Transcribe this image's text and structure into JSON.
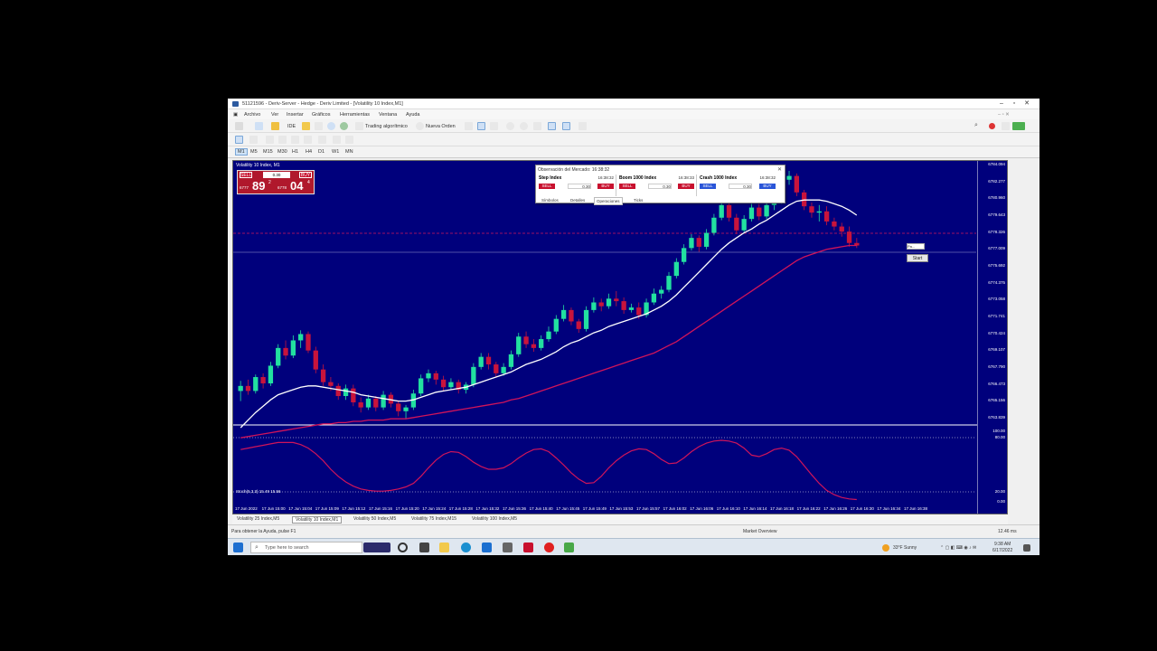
{
  "window": {
    "title": "51121596 - Deriv-Server - Hedge - Deriv Limited - [Volatility 10 Index,M1]"
  },
  "menu": [
    "Archivo",
    "Ver",
    "Insertar",
    "Gráficos",
    "Herramientas",
    "Ventana",
    "Ayuda"
  ],
  "toolbar": {
    "ide_label": "IDE",
    "algo_trading": "Trading algorítmico",
    "new_order": "Nueva Orden"
  },
  "timeframes": [
    "M1",
    "M5",
    "M15",
    "M30",
    "H1",
    "H4",
    "D1",
    "W1",
    "MN"
  ],
  "active_timeframe": "M1",
  "chart": {
    "title": "Volatility 10 Index, M1",
    "background": "#00007c",
    "bull_color": "#22e0a0",
    "bear_color": "#c8143c",
    "fast_ma_color": "#ffffff",
    "slow_ma_color": "#d0145a",
    "price_labels": [
      "6784.094",
      "6782.277",
      "6780.960",
      "6779.643",
      "6778.326",
      "6777.009",
      "6775.692",
      "6774.375",
      "6773.058",
      "6771.741",
      "6770.424",
      "6769.107",
      "6767.790",
      "6766.473",
      "6765.156",
      "6763.839"
    ],
    "time_labels": [
      "17 Jun 2022",
      "17 Jun 15:00",
      "17 Jun 15:04",
      "17 Jun 15:09",
      "17 Jun 15:12",
      "17 Jun 15:16",
      "17 Jun 15:20",
      "17 Jun 15:24",
      "17 Jun 15:28",
      "17 Jun 15:32",
      "17 Jun 15:36",
      "17 Jun 15:40",
      "17 Jun 15:45",
      "17 Jun 15:49",
      "17 Jun 15:53",
      "17 Jun 15:57",
      "17 Jun 16:02",
      "17 Jun 16:06",
      "17 Jun 16:10",
      "17 Jun 16:14",
      "17 Jun 16:18",
      "17 Jun 16:22",
      "17 Jun 16:26",
      "17 Jun 16:30",
      "17 Jun 16:34",
      "17 Jun 16:38"
    ],
    "oscillator_title": "Stoch(5,3,3) 15.49 15.56",
    "osc_levels": [
      "100.00",
      "80.00",
      "20.00",
      "0.00"
    ]
  },
  "trade_panel": {
    "sell": "SELL",
    "buy": "BUY",
    "lot": "0.30",
    "sell_small": "6777",
    "sell_big": "89",
    "sell_sup": "2",
    "buy_small": "6778",
    "buy_big": "04",
    "buy_sup": "4"
  },
  "market_watch": {
    "title": "Observación del Mercado: 16:38:32",
    "symbols": [
      {
        "name": "Step Index",
        "time": "16:38:32",
        "lot": "0.30",
        "sell": "SELL",
        "buy": "BUY"
      },
      {
        "name": "Boom 1000 Index",
        "time": "16:38:33",
        "lot": "0.30",
        "sell": "SELL",
        "buy": "BUY"
      },
      {
        "name": "Crash 1000 Index",
        "time": "16:38:32",
        "lot": "0.30",
        "sell": "SELL",
        "buy": "BUY"
      }
    ],
    "tabs": [
      "Símbolos",
      "Detalles",
      "Operaciones",
      "Ticks"
    ],
    "active_tab": "Operaciones"
  },
  "start_widget": {
    "field": "Pa...",
    "button": "Start"
  },
  "bottom_tabs": [
    "Volatility 25 Index,M5",
    "Volatility 10 Index,M1",
    "Volatility 50 Index,M5",
    "Volatility 75 Index,M15",
    "Volatility 100 Index,M5"
  ],
  "active_bottom_tab": 1,
  "status": {
    "help": "Para obtener la Ayuda, pulse F1",
    "panel": "Market Overview",
    "net": "12.46 ms"
  },
  "taskbar": {
    "search_placeholder": "Type here to search",
    "weather": "33°F  Sunny",
    "time": "9:38 AM",
    "date": "6/17/2022"
  },
  "chart_data": {
    "type": "candlestick",
    "y_range": [
      6763.8,
      6784.1
    ],
    "candles": [
      [
        6766.2,
        6767.0,
        6765.4,
        6766.6
      ],
      [
        6766.6,
        6767.1,
        6765.9,
        6766.2
      ],
      [
        6766.2,
        6767.5,
        6766.0,
        6767.3
      ],
      [
        6767.3,
        6767.6,
        6766.4,
        6766.8
      ],
      [
        6766.8,
        6768.5,
        6766.6,
        6768.2
      ],
      [
        6768.2,
        6769.9,
        6768.0,
        6769.6
      ],
      [
        6769.6,
        6770.2,
        6768.7,
        6769.0
      ],
      [
        6769.0,
        6770.6,
        6768.8,
        6770.2
      ],
      [
        6770.2,
        6771.0,
        6769.6,
        6770.7
      ],
      [
        6770.7,
        6770.9,
        6769.2,
        6769.4
      ],
      [
        6769.4,
        6769.7,
        6767.6,
        6767.9
      ],
      [
        6767.9,
        6768.3,
        6766.6,
        6766.9
      ],
      [
        6766.9,
        6767.3,
        6766.2,
        6766.6
      ],
      [
        6766.6,
        6766.8,
        6765.5,
        6765.8
      ],
      [
        6765.8,
        6766.7,
        6765.5,
        6766.4
      ],
      [
        6766.4,
        6766.7,
        6765.0,
        6765.3
      ],
      [
        6765.3,
        6765.7,
        6764.5,
        6764.9
      ],
      [
        6764.9,
        6765.9,
        6764.7,
        6765.6
      ],
      [
        6765.6,
        6765.8,
        6764.6,
        6764.9
      ],
      [
        6764.9,
        6766.2,
        6764.7,
        6765.9
      ],
      [
        6765.9,
        6766.1,
        6764.9,
        6765.2
      ],
      [
        6765.2,
        6765.4,
        6764.2,
        6764.6
      ],
      [
        6764.6,
        6765.1,
        6764.0,
        6764.9
      ],
      [
        6764.9,
        6766.3,
        6764.7,
        6766.0
      ],
      [
        6766.0,
        6767.5,
        6765.8,
        6767.2
      ],
      [
        6767.2,
        6767.9,
        6766.9,
        6767.6
      ],
      [
        6767.6,
        6767.8,
        6766.7,
        6767.1
      ],
      [
        6767.1,
        6767.4,
        6766.2,
        6766.5
      ],
      [
        6766.5,
        6767.2,
        6766.3,
        6766.9
      ],
      [
        6766.9,
        6767.1,
        6766.0,
        6766.3
      ],
      [
        6766.3,
        6766.9,
        6766.0,
        6766.7
      ],
      [
        6766.7,
        6768.4,
        6766.5,
        6768.1
      ],
      [
        6768.1,
        6769.2,
        6767.9,
        6768.9
      ],
      [
        6768.9,
        6769.2,
        6767.9,
        6768.3
      ],
      [
        6768.3,
        6768.5,
        6767.3,
        6767.6
      ],
      [
        6767.6,
        6768.4,
        6767.4,
        6768.1
      ],
      [
        6768.1,
        6769.4,
        6767.9,
        6769.1
      ],
      [
        6769.1,
        6770.8,
        6768.9,
        6770.5
      ],
      [
        6770.5,
        6770.9,
        6769.6,
        6769.9
      ],
      [
        6769.9,
        6770.3,
        6769.3,
        6769.6
      ],
      [
        6769.6,
        6770.6,
        6769.4,
        6770.3
      ],
      [
        6770.3,
        6771.3,
        6770.1,
        6770.9
      ],
      [
        6770.9,
        6772.2,
        6770.7,
        6771.9
      ],
      [
        6771.9,
        6773.0,
        6771.7,
        6772.6
      ],
      [
        6772.6,
        6772.8,
        6771.4,
        6771.7
      ],
      [
        6771.7,
        6771.9,
        6770.8,
        6771.1
      ],
      [
        6771.1,
        6772.9,
        6770.9,
        6772.6
      ],
      [
        6772.6,
        6773.6,
        6772.4,
        6773.2
      ],
      [
        6773.2,
        6773.5,
        6772.5,
        6772.9
      ],
      [
        6772.9,
        6773.9,
        6772.7,
        6773.5
      ],
      [
        6773.5,
        6774.1,
        6772.9,
        6773.3
      ],
      [
        6773.3,
        6773.6,
        6772.3,
        6772.6
      ],
      [
        6772.6,
        6773.1,
        6772.4,
        6772.8
      ],
      [
        6772.8,
        6773.2,
        6771.9,
        6772.2
      ],
      [
        6772.2,
        6773.5,
        6772.0,
        6773.2
      ],
      [
        6773.2,
        6774.3,
        6773.0,
        6773.9
      ],
      [
        6773.9,
        6774.5,
        6773.5,
        6774.2
      ],
      [
        6774.2,
        6775.6,
        6774.0,
        6775.3
      ],
      [
        6775.3,
        6776.7,
        6775.1,
        6776.4
      ],
      [
        6776.4,
        6777.8,
        6776.2,
        6777.5
      ],
      [
        6777.5,
        6778.6,
        6777.3,
        6778.3
      ],
      [
        6778.3,
        6778.5,
        6777.2,
        6777.6
      ],
      [
        6777.6,
        6779.0,
        6777.4,
        6778.7
      ],
      [
        6778.7,
        6780.2,
        6778.5,
        6779.9
      ],
      [
        6779.9,
        6781.2,
        6779.7,
        6780.9
      ],
      [
        6780.9,
        6781.1,
        6779.6,
        6779.9
      ],
      [
        6779.9,
        6780.2,
        6778.6,
        6778.9
      ],
      [
        6778.9,
        6780.1,
        6778.7,
        6779.8
      ],
      [
        6779.8,
        6781.0,
        6779.6,
        6780.7
      ],
      [
        6780.7,
        6781.0,
        6779.7,
        6780.0
      ],
      [
        6780.0,
        6781.2,
        6779.8,
        6780.9
      ],
      [
        6780.9,
        6781.6,
        6780.5,
        6781.2
      ],
      [
        6781.2,
        6783.2,
        6781.0,
        6782.9
      ],
      [
        6782.9,
        6783.6,
        6782.5,
        6783.2
      ],
      [
        6783.2,
        6783.4,
        6781.6,
        6781.9
      ],
      [
        6781.9,
        6782.1,
        6780.5,
        6780.8
      ],
      [
        6780.8,
        6781.1,
        6779.9,
        6780.3
      ],
      [
        6780.3,
        6780.9,
        6779.6,
        6780.4
      ],
      [
        6780.4,
        6780.8,
        6779.3,
        6779.6
      ],
      [
        6779.6,
        6779.9,
        6778.9,
        6779.2
      ],
      [
        6779.2,
        6779.5,
        6778.4,
        6778.8
      ],
      [
        6778.8,
        6779.2,
        6777.6,
        6777.9
      ],
      [
        6777.9,
        6778.3,
        6777.5,
        6777.7
      ]
    ],
    "fast_ma": [
      6763.3,
      6763.9,
      6764.5,
      6765.0,
      6765.5,
      6765.9,
      6766.1,
      6766.3,
      6766.5,
      6766.6,
      6766.6,
      6766.5,
      6766.4,
      6766.3,
      6766.2,
      6766.1,
      6765.9,
      6765.8,
      6765.7,
      6765.6,
      6765.5,
      6765.4,
      6765.4,
      6765.5,
      6765.7,
      6765.9,
      6766.1,
      6766.2,
      6766.3,
      6766.4,
      6766.5,
      6766.7,
      6766.9,
      6767.1,
      6767.3,
      6767.5,
      6767.7,
      6768.0,
      6768.3,
      6768.5,
      6768.7,
      6769.0,
      6769.3,
      6769.7,
      6770.0,
      6770.2,
      6770.5,
      6770.8,
      6771.0,
      6771.3,
      6771.5,
      6771.7,
      6771.9,
      6772.1,
      6772.3,
      6772.6,
      6772.9,
      6773.3,
      6773.8,
      6774.4,
      6775.0,
      6775.6,
      6776.2,
      6776.8,
      6777.4,
      6777.9,
      6778.3,
      6778.7,
      6779.0,
      6779.4,
      6779.7,
      6780.1,
      6780.5,
      6780.9,
      6781.2,
      6781.3,
      6781.3,
      6781.3,
      6781.2,
      6781.0,
      6780.8,
      6780.5,
      6780.1
    ],
    "slow_ma": [
      6762.5,
      6762.6,
      6762.7,
      6762.8,
      6762.9,
      6763.0,
      6763.1,
      6763.2,
      6763.3,
      6763.4,
      6763.5,
      6763.6,
      6763.6,
      6763.7,
      6763.7,
      6763.8,
      6763.8,
      6763.9,
      6763.9,
      6763.9,
      6764.0,
      6764.0,
      6764.0,
      6764.1,
      6764.2,
      6764.3,
      6764.4,
      6764.5,
      6764.6,
      6764.7,
      6764.8,
      6764.9,
      6765.0,
      6765.1,
      6765.2,
      6765.3,
      6765.5,
      6765.6,
      6765.8,
      6766.0,
      6766.2,
      6766.4,
      6766.6,
      6766.8,
      6767.0,
      6767.2,
      6767.4,
      6767.6,
      6767.8,
      6768.0,
      6768.2,
      6768.4,
      6768.6,
      6768.8,
      6769.0,
      6769.2,
      6769.5,
      6769.8,
      6770.1,
      6770.5,
      6770.9,
      6771.3,
      6771.7,
      6772.1,
      6772.5,
      6772.9,
      6773.3,
      6773.7,
      6774.1,
      6774.5,
      6774.9,
      6775.3,
      6775.7,
      6776.1,
      6776.5,
      6776.8,
      6777.0,
      6777.2,
      6777.4,
      6777.5,
      6777.6,
      6777.7,
      6777.7
    ],
    "stoch": [
      78,
      80,
      82,
      84,
      86,
      88,
      88,
      88,
      85,
      80,
      72,
      62,
      50,
      40,
      32,
      26,
      22,
      20,
      19,
      19,
      20,
      22,
      25,
      30,
      40,
      52,
      63,
      71,
      75,
      74,
      68,
      60,
      54,
      50,
      50,
      52,
      58,
      66,
      73,
      78,
      79,
      75,
      66,
      56,
      45,
      36,
      30,
      31,
      40,
      52,
      62,
      70,
      76,
      79,
      78,
      72,
      64,
      58,
      59,
      66,
      75,
      82,
      87,
      90,
      91,
      90,
      87,
      80,
      70,
      68,
      72,
      78,
      80,
      77,
      68,
      55,
      42,
      30,
      20,
      14,
      10,
      8,
      7
    ]
  }
}
